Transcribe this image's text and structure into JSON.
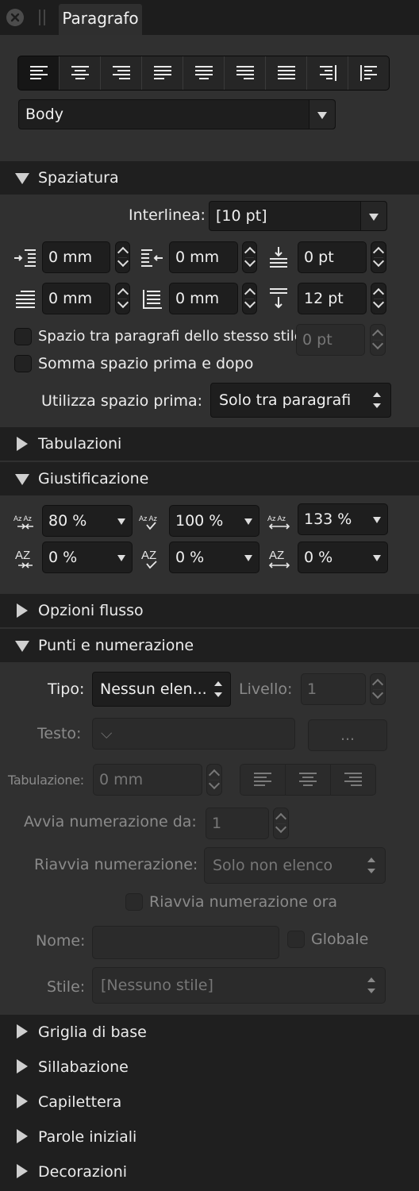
{
  "tab": {
    "title": "Paragrafo"
  },
  "alignment": {
    "buttons": [
      "align-left",
      "align-center",
      "align-right",
      "justify-left",
      "justify-center",
      "justify-right",
      "justify-all",
      "align-towards-spine",
      "align-away-from-spine"
    ],
    "selected": 0
  },
  "style": {
    "value": "Body"
  },
  "sections": {
    "spaziatura": "Spaziatura",
    "tabulazioni": "Tabulazioni",
    "giustificazione": "Giustificazione",
    "opzioni_flusso": "Opzioni flusso",
    "punti": "Punti e numerazione",
    "griglia": "Griglia di base",
    "sillabazione": "Sillabazione",
    "capilettera": "Capilettera",
    "parole": "Parole iniziali",
    "decorazioni": "Decorazioni"
  },
  "spacing": {
    "interlinea_label": "Interlinea:",
    "interlinea_value": "[10 pt]",
    "left_indent": "0 mm",
    "right_indent": "0 mm",
    "space_before": "0 pt",
    "first_line_indent": "0 mm",
    "last_line_indent": "0 mm",
    "space_after": "12 pt",
    "same_style_label": "Spazio tra paragrafi dello stesso stile:",
    "same_style_value": "0 pt",
    "sum_label": "Somma spazio prima e dopo",
    "use_before_label": "Utilizza spazio prima:",
    "use_before_value": "Solo tra paragrafi"
  },
  "justification": {
    "word_min": "80 %",
    "word_desired": "100 %",
    "word_max": "133 %",
    "letter_min": "0 %",
    "letter_desired": "0 %",
    "letter_max": "0 %",
    "icon_text": "Az Az",
    "icon_letter": "AZ"
  },
  "bullets": {
    "tipo_label": "Tipo:",
    "tipo_value": "Nessun elen...",
    "livello_label": "Livello:",
    "livello_value": "1",
    "testo_label": "Testo:",
    "testo_value": "⌵",
    "ellipsis_button": "...",
    "tab_label": "Tabulazione:",
    "tab_value": "0 mm",
    "start_label": "Avvia numerazione da:",
    "start_value": "1",
    "restart_label": "Riavvia numerazione:",
    "restart_value": "Solo non elenco",
    "restart_now_label": "Riavvia numerazione ora",
    "nome_label": "Nome:",
    "nome_value": "",
    "globale_label": "Globale",
    "stile_label": "Stile:",
    "stile_value": "[Nessuno stile]"
  }
}
